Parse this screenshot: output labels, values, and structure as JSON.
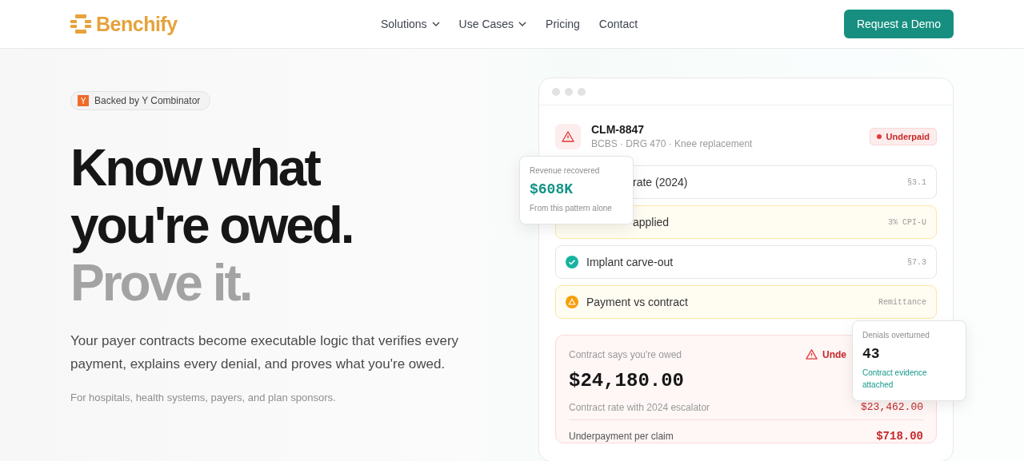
{
  "header": {
    "brand": "Benchify",
    "nav": [
      {
        "label": "Solutions",
        "dropdown": true
      },
      {
        "label": "Use Cases",
        "dropdown": true
      },
      {
        "label": "Pricing",
        "dropdown": false
      },
      {
        "label": "Contact",
        "dropdown": false
      }
    ],
    "cta": "Request a Demo"
  },
  "hero": {
    "badge": {
      "mark": "Y",
      "label": "Backed by Y Combinator"
    },
    "headline": [
      "Know what",
      "you're owed."
    ],
    "headline_accent": "Prove it.",
    "description": "Your payer contracts become executable logic that verifies every payment, explains every denial, and proves what you're owed.",
    "audience": "For hospitals, health systems, payers, and plan sponsors."
  },
  "claim_card": {
    "claim_id": "CLM-8847",
    "details": "BCBS · DRG 470 · Knee replacement",
    "status": "Underpaid",
    "checks": [
      {
        "label": "rate (2024)",
        "ref": "§3.1",
        "kind": "ok"
      },
      {
        "label": "applied",
        "ref": "3% CPI-U",
        "kind": "warn"
      },
      {
        "label": "Implant carve-out",
        "ref": "§7.3",
        "kind": "ok"
      },
      {
        "label": "Payment vs contract",
        "ref": "Remittance",
        "kind": "warn"
      }
    ],
    "summary": {
      "label": "Contract says you're owed",
      "flag": "Unde",
      "amount": "$24,180.00",
      "note": "Contract rate with 2024 escalator",
      "paid": "$23,462.00",
      "shortfall_label": "Underpayment per claim",
      "shortfall": "$718.00"
    }
  },
  "floating_cards": [
    {
      "label": "Revenue recovered",
      "value": "$608K",
      "note": "From this pattern alone",
      "accent": true
    },
    {
      "label": "Denials overturned",
      "value": "43",
      "note": "Contract evidence attached",
      "accent": false
    }
  ]
}
